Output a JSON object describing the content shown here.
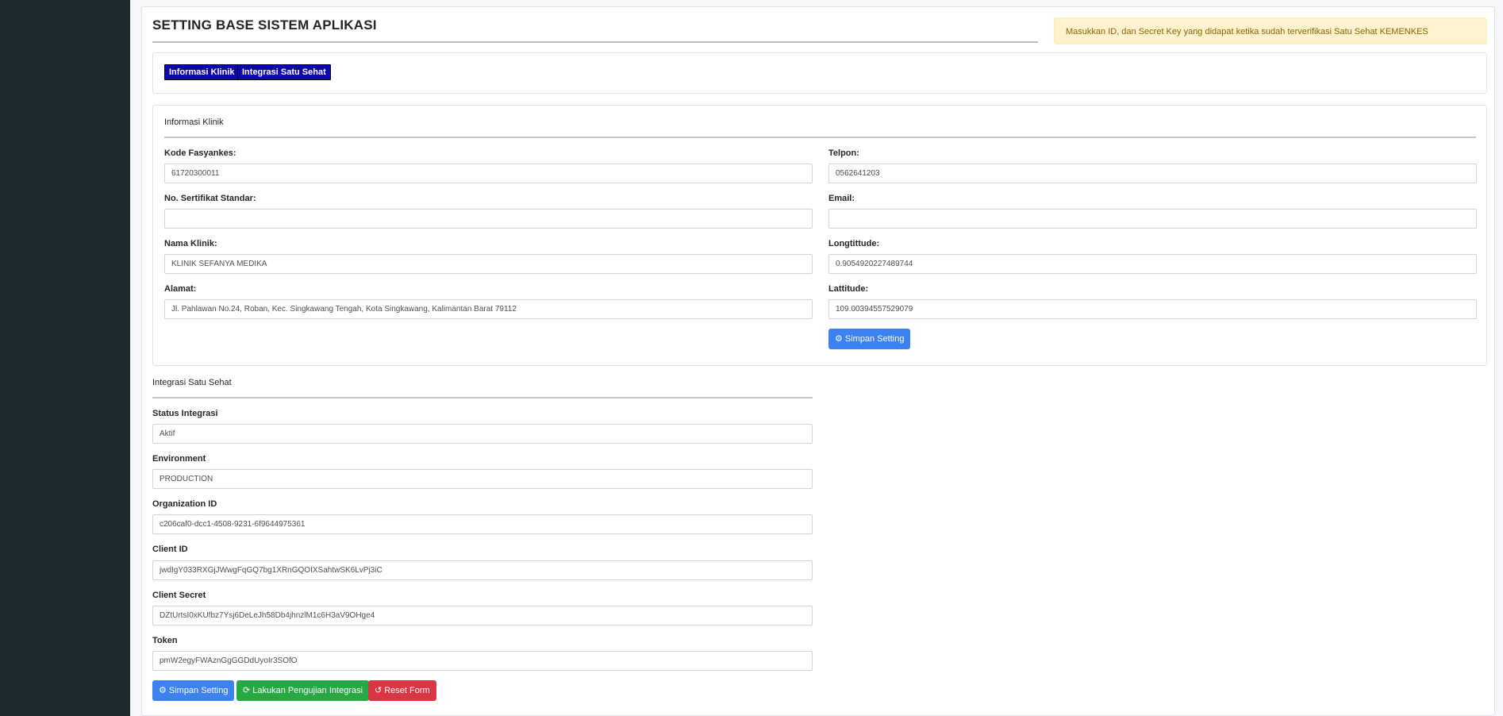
{
  "page": {
    "title": "SETTING BASE SISTEM APLIKASI",
    "alert_text": "Masukkan ID, dan Secret Key yang didapat ketika sudah terverifikasi Satu Sehat KEMENKES"
  },
  "tabs": [
    {
      "label": "Informasi Klinik"
    },
    {
      "label": "Integrasi Satu Sehat"
    }
  ],
  "clinic": {
    "section_title": "Informasi Klinik",
    "fields": {
      "kode_fasyankes": {
        "label": "Kode Fasyankes:",
        "value": "61720300011"
      },
      "no_sertifikat": {
        "label": "No. Sertifikat Standar:",
        "value": ""
      },
      "nama_klinik": {
        "label": "Nama Klinik:",
        "value": "KLINIK SEFANYA MEDIKA"
      },
      "alamat": {
        "label": "Alamat:",
        "value": "Jl. Pahlawan No.24, Roban, Kec. Singkawang Tengah, Kota Singkawang, Kalimantan Barat 79112"
      },
      "telpon": {
        "label": "Telpon:",
        "value": "0562641203"
      },
      "email": {
        "label": "Email:",
        "value": ""
      },
      "longtittude": {
        "label": "Longtittude:",
        "value": "0.9054920227489744"
      },
      "lattitude": {
        "label": "Lattitude:",
        "value": "109.00394557529079"
      }
    },
    "save_label": "Simpan Setting",
    "save_icon": "gear-icon"
  },
  "integration": {
    "section_title": "Integrasi Satu Sehat",
    "fields": {
      "status": {
        "label": "Status Integrasi",
        "value": "Aktif"
      },
      "environment": {
        "label": "Environment",
        "value": "PRODUCTION"
      },
      "organization_id": {
        "label": "Organization ID",
        "value": "c206caf0-dcc1-4508-9231-6f9644975361"
      },
      "client_id": {
        "label": "Client ID",
        "value": "jwdIgY033RXGjJWwgFqGQ7bg1XRnGQOIXSahtwSK6LvPj3iC"
      },
      "client_secret": {
        "label": "Client Secret",
        "value": "DZtUrtsI0xKUfbz7Ysj6DeLeJh58Db4jhnzlM1c6H3aV9OHge4"
      },
      "token": {
        "label": "Token",
        "value": "pmW2egyFWAznGgGGDdUyoIr3SOfO"
      }
    },
    "buttons": {
      "save": {
        "label": "Simpan Setting",
        "icon": "gear-icon"
      },
      "test": {
        "label": "Lakukan Pengujian Integrasi",
        "icon": "refresh-icon"
      },
      "reset": {
        "label": "Reset Form",
        "icon": "undo-icon"
      }
    }
  },
  "colors": {
    "primary": "#3b82f0",
    "success": "#28a745",
    "danger": "#dc3545",
    "tab": "#0d05b3",
    "sidebar": "#1f2a30",
    "alert_bg": "#fff3cd"
  }
}
